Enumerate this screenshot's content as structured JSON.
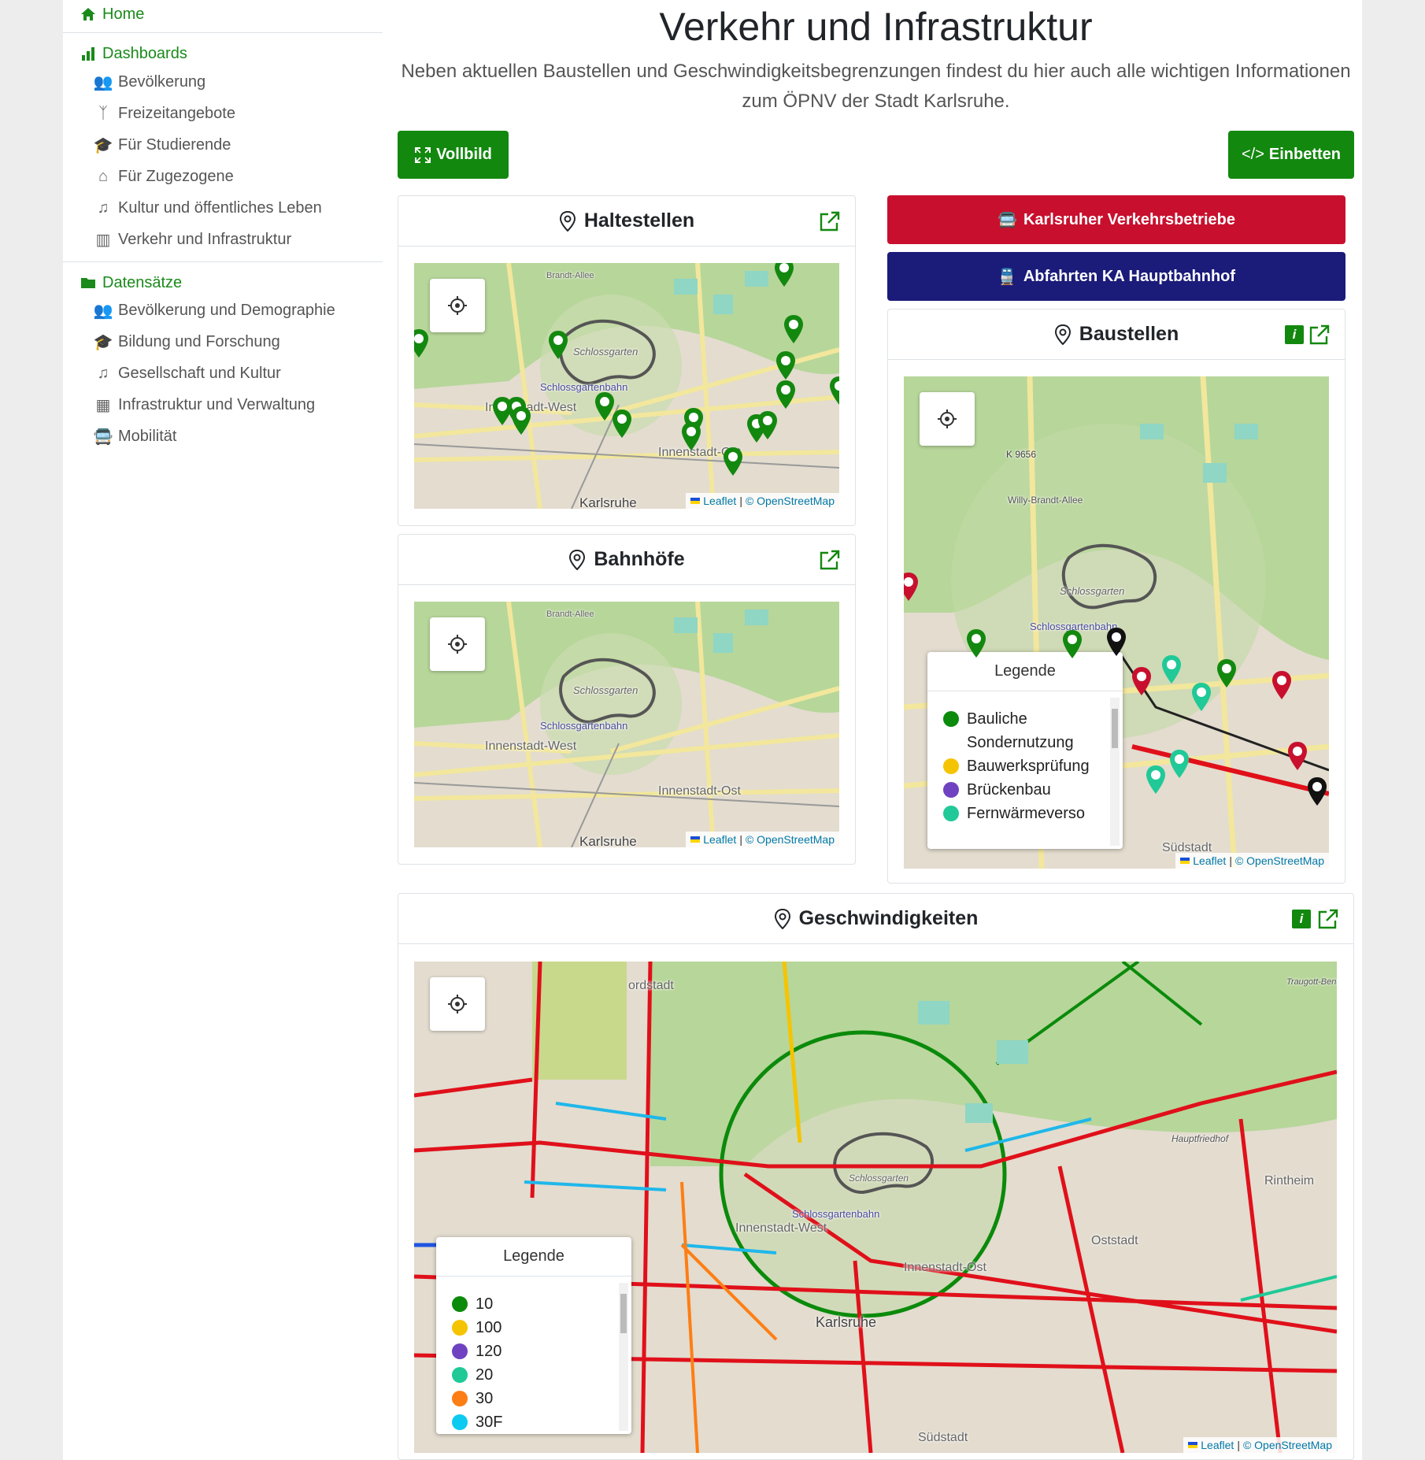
{
  "sidebar": {
    "home": "Home",
    "dashboards": {
      "label": "Dashboards",
      "items": [
        "Bevölkerung",
        "Freizeitangebote",
        "Für Studierende",
        "Für Zugezogene",
        "Kultur und öffentliches Leben",
        "Verkehr und Infrastruktur"
      ]
    },
    "datasets": {
      "label": "Datensätze",
      "items": [
        "Bevölkerung und Demographie",
        "Bildung und Forschung",
        "Gesellschaft und Kultur",
        "Infrastruktur und Verwaltung",
        "Mobilität"
      ]
    }
  },
  "main": {
    "title": "Verkehr und Infrastruktur",
    "lead": "Neben aktuellen Baustellen und Geschwindigkeitsbegrenzungen findest du hier auch alle wichtigen Informationen zum ÖPNV der Stadt Karlsruhe.",
    "fullscreen_label": "Vollbild",
    "embed_label": "Einbetten",
    "kvv_label": "Karlsruher Verkehrsbetriebe",
    "departures_label": "Abfahrten KA Hauptbahnhof"
  },
  "cards": {
    "stops": {
      "title": "Haltestellen"
    },
    "stations": {
      "title": "Bahnhöfe"
    },
    "construction": {
      "title": "Baustellen",
      "info": "i"
    },
    "speeds": {
      "title": "Geschwindigkeiten",
      "info": "i"
    }
  },
  "map_labels": {
    "schlossgarten": "Schlossgarten",
    "schlossgartenbahn": "Schlossgartenbahn",
    "innenstadt_west": "Innenstadt-West",
    "innenstadt_ost": "Innenstadt-Ost",
    "karlsruhe": "Karlsruhe",
    "suedstadt": "Südstadt",
    "oststadt": "Oststadt",
    "rintheim": "Rintheim",
    "nordstadt": "ordstadt",
    "hauptfriedhof": "Hauptfriedhof",
    "sportpark": "Traugott-Bender-Sportpark",
    "k9656": "K 9656",
    "willy_brandt": "Willy-Brandt-Allee",
    "brandt_allee": "Brandt-Allee"
  },
  "attribution": {
    "leaflet": "Leaflet",
    "sep": "|",
    "copy": "© OpenStreetMap",
    "osm": "OpenStreetMap"
  },
  "legend_construction": {
    "title": "Legende",
    "items": [
      {
        "label": "Bauliche Sondernutzung",
        "color": "#0b8a0b"
      },
      {
        "label": "Bauwerksprüfung",
        "color": "#f5c400"
      },
      {
        "label": "Brückenbau",
        "color": "#6f42c1"
      },
      {
        "label": "Fernwärmeverso",
        "color": "#20c997"
      }
    ]
  },
  "legend_speeds": {
    "title": "Legende",
    "items": [
      {
        "label": "10",
        "color": "#0b8a0b"
      },
      {
        "label": "100",
        "color": "#f5c400"
      },
      {
        "label": "120",
        "color": "#6f42c1"
      },
      {
        "label": "20",
        "color": "#20c997"
      },
      {
        "label": "30",
        "color": "#fd7e14"
      },
      {
        "label": "30F",
        "color": "#0dcaf0"
      }
    ]
  },
  "colors": {
    "brand_green": "#13880f",
    "kvv_red": "#c8102e",
    "db_navy": "#1b1b7a",
    "speed_red": "#e0101a"
  }
}
